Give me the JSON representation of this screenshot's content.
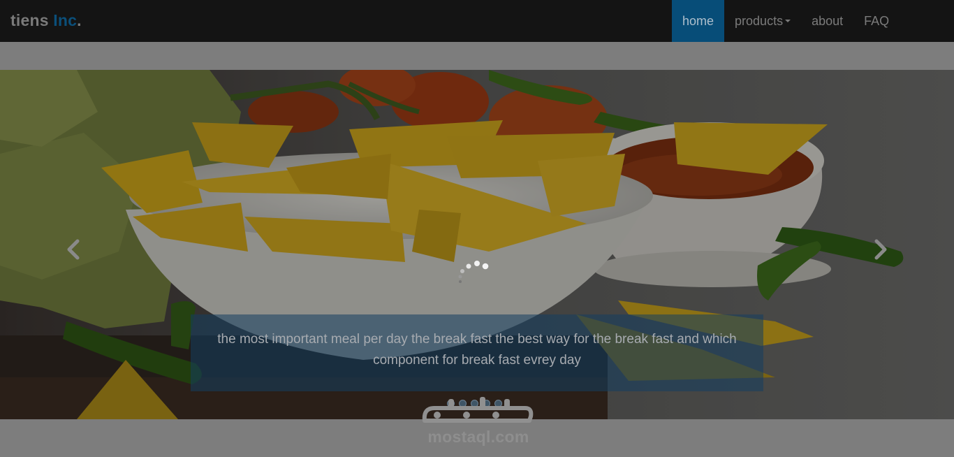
{
  "brand": {
    "name": "tiens",
    "accent": "Inc",
    "dot": "."
  },
  "nav": {
    "items": [
      {
        "label": "home",
        "active": true
      },
      {
        "label": "products",
        "dropdown": true
      },
      {
        "label": "about"
      },
      {
        "label": "FAQ"
      }
    ]
  },
  "carousel": {
    "caption": "the most important meal per day the break fast the best way for the break fast and which component for break fast evrey day",
    "indicator_count": 5,
    "prev_icon": "chevron-left-icon",
    "next_icon": "chevron-right-icon",
    "loading_icon": "spinner-icon"
  },
  "watermark": {
    "logo_text": "مستقل",
    "text": "mostaql.com"
  },
  "colors": {
    "navbar_bg": "#141414",
    "active_nav_bg": "#074d78",
    "brand_accent": "#0b4f7a",
    "page_overlay": "#7d7d7d",
    "caption_bg": "#143e60"
  }
}
